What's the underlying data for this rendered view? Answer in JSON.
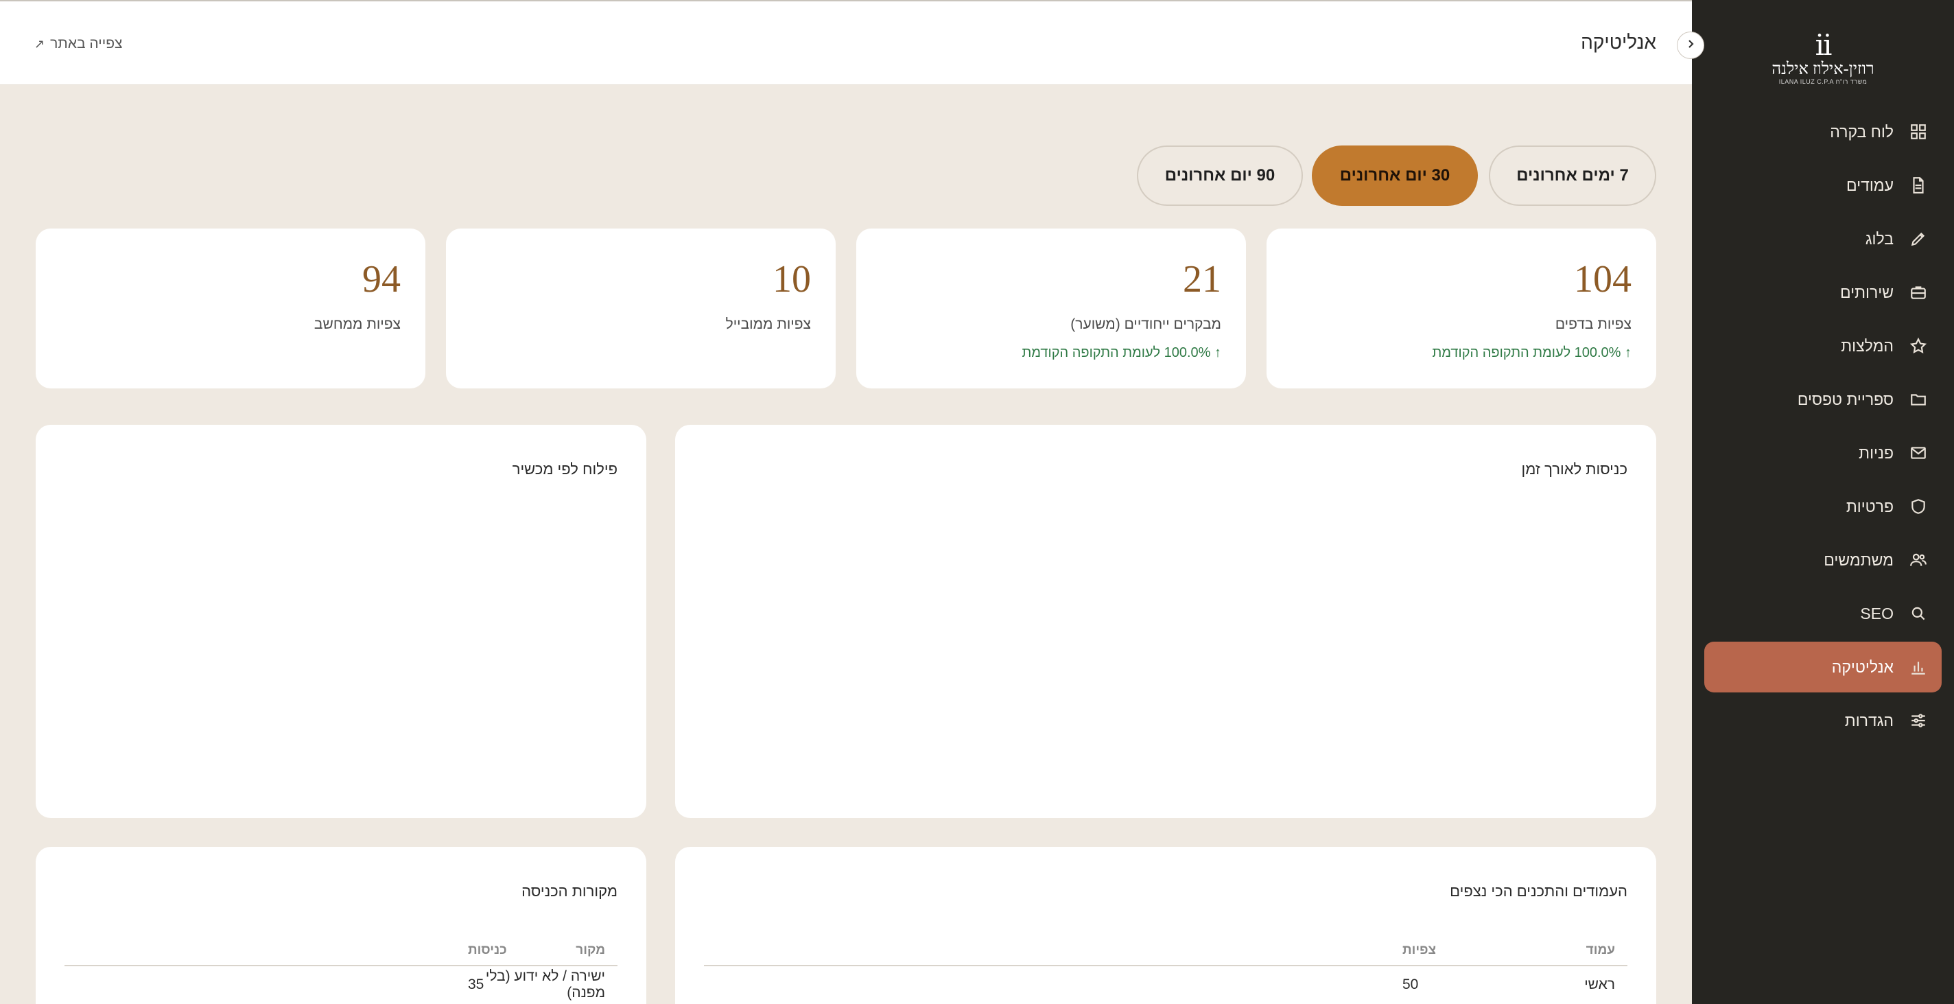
{
  "app": {
    "logo_mark": "ii",
    "logo_name": "רוזין-אילוז אילנה",
    "logo_sub": "ILANA ILUZ C.P.A משרד רו\"ח"
  },
  "sidebar": {
    "items": [
      {
        "label": "לוח בקרה",
        "icon": "grid-icon"
      },
      {
        "label": "עמודים",
        "icon": "file-icon"
      },
      {
        "label": "בלוג",
        "icon": "pencil-icon"
      },
      {
        "label": "שירותים",
        "icon": "briefcase-icon"
      },
      {
        "label": "המלצות",
        "icon": "star-icon"
      },
      {
        "label": "ספריית טפסים",
        "icon": "folder-icon"
      },
      {
        "label": "פניות",
        "icon": "mail-icon"
      },
      {
        "label": "פרטיות",
        "icon": "shield-icon"
      },
      {
        "label": "משתמשים",
        "icon": "users-icon"
      },
      {
        "label": "SEO",
        "icon": "search-icon"
      },
      {
        "label": "אנליטיקה",
        "icon": "bar-chart-icon",
        "active": true
      },
      {
        "label": "הגדרות",
        "icon": "sliders-icon"
      }
    ]
  },
  "header": {
    "title": "אנליטיקה",
    "view_site": "צפייה באתר",
    "view_site_icon": "external-link-icon"
  },
  "ranges": {
    "r7": "7 ימים אחרונים",
    "r30": "30 יום אחרונים",
    "r90": "90 יום אחרונים",
    "selected": "30 יום אחרונים"
  },
  "kpis": {
    "page_views": {
      "value": "104",
      "label": "צפיות בדפים",
      "delta": "↑ 100.0% לעומת התקופה הקודמת"
    },
    "unique_visitors": {
      "value": "21",
      "label": "מבקרים ייחודיים (משוער)",
      "delta": "↑ 100.0% לעומת התקופה הקודמת"
    },
    "mobile_views": {
      "value": "10",
      "label": "צפיות ממובייל"
    },
    "desktop_views": {
      "value": "94",
      "label": "צפיות ממחשב"
    }
  },
  "charts": {
    "visits_over_time": "כניסות לאורך זמן",
    "device_split": "פילוח לפי מכשיר"
  },
  "top_pages": {
    "title": "העמודים והתכנים הכי נצפים",
    "col_page": "עמוד",
    "col_views": "צפיות",
    "rows": [
      {
        "page": "ראשי",
        "views": "50"
      }
    ]
  },
  "sources": {
    "title": "מקורות הכניסה",
    "col_source": "מקור",
    "col_visits": "כניסות",
    "rows": [
      {
        "source": "ישירה / לא ידוע (בלי מפנה)",
        "visits": "35"
      }
    ]
  },
  "colors": {
    "sidebar_bg": "#262521",
    "active_nav": "#b8664c",
    "active_range": "#c17a2e",
    "kpi_value": "#8c5a26",
    "delta_positive": "#2f7a45",
    "page_bg": "#efe9e1"
  }
}
